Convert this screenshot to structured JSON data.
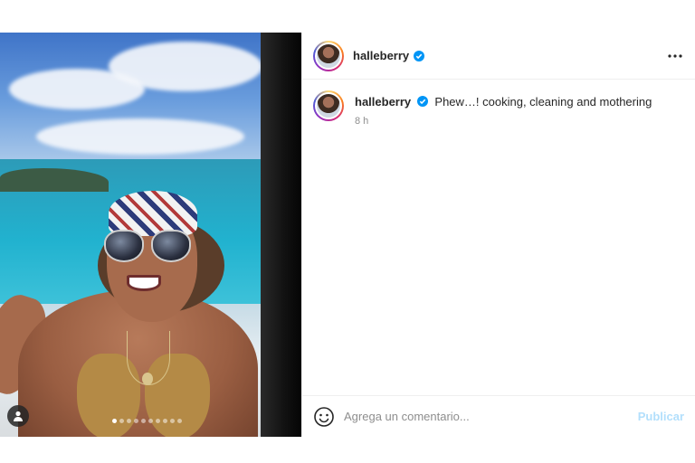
{
  "post": {
    "username": "halleberry",
    "verified": true,
    "caption": "Phew…! cooking, cleaning and mothering",
    "time_ago": "8 h",
    "carousel": {
      "count": 10,
      "active_index": 0
    }
  },
  "header": {
    "more_icon": "more-horizontal-icon"
  },
  "comment_box": {
    "placeholder": "Agrega un comentario...",
    "publish_label": "Publicar",
    "emoji_icon": "smiley-icon"
  },
  "colors": {
    "verified_blue": "#0095f6",
    "publish_disabled": "#b2dffc",
    "secondary_text": "#8e8e8e"
  }
}
